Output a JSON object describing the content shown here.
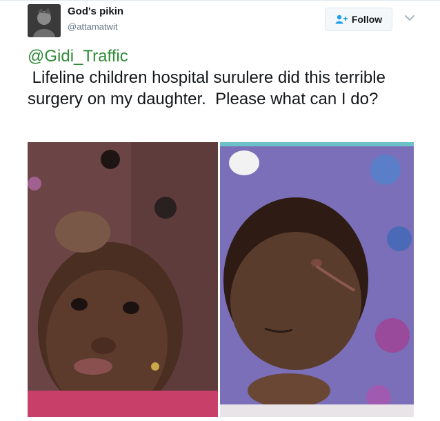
{
  "user": {
    "name": "God's pikin",
    "handle": "@attamatwit",
    "avatar_icon": "profile-avatar-icon"
  },
  "follow_button": {
    "label": "Follow",
    "icon": "add-user-icon"
  },
  "menu": {
    "icon": "chevron-down-icon"
  },
  "tweet": {
    "mention": "@Gidi_Traffic",
    "text": " Lifeline children hospital surulere did this terrible surgery on my daughter.  Please what can I do?"
  },
  "media": [
    {
      "name": "photo-child-before"
    },
    {
      "name": "photo-child-after"
    }
  ],
  "colors": {
    "mention": "#2e8b36",
    "name": "#14171a",
    "handle": "#657786",
    "border": "#e1e8ed"
  }
}
